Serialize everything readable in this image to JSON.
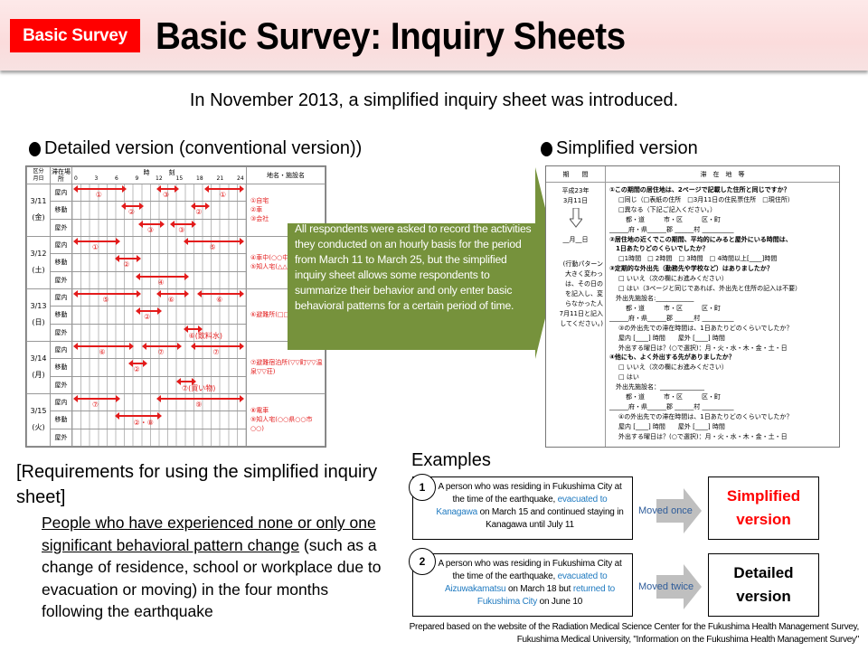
{
  "header": {
    "badge": "Basic Survey",
    "title": "Basic Survey: Inquiry Sheets"
  },
  "subtitle": "In November 2013, a simplified inquiry sheet was introduced.",
  "detailed": {
    "heading": "Detailed version (conventional version))",
    "sheet": {
      "corner_top": "区分",
      "corner_bottom": "月日",
      "stay_header": "滞在場所",
      "time_header": "時　　　刻",
      "hour_ticks": [
        "0",
        "3",
        "6",
        "9",
        "12",
        "15",
        "18",
        "21",
        "24"
      ],
      "place_header": "地名・施設名",
      "row_types": [
        "屋内",
        "移動",
        "屋外"
      ],
      "days": [
        {
          "date": "3/11",
          "dow": "(金)",
          "places": "①自宅\n②車\n③会社",
          "bars": [
            [
              {
                "from": 0,
                "to": 7,
                "label": "①"
              },
              {
                "from": 12,
                "to": 14.5,
                "label": "③"
              },
              {
                "from": 19,
                "to": 24,
                "label": "①"
              }
            ],
            [
              {
                "from": 7,
                "to": 9.5,
                "label": "②"
              },
              {
                "from": 17,
                "to": 19,
                "label": "②"
              }
            ],
            [
              {
                "from": 9.5,
                "to": 12.5,
                "label": "③"
              },
              {
                "from": 14,
                "to": 17,
                "label": "③"
              }
            ]
          ]
        },
        {
          "date": "3/12",
          "dow": "(土)",
          "places": "④車中(○○中学校校庭)\n⑤知人宅(△△町字△△)",
          "bars": [
            [
              {
                "from": 0,
                "to": 6,
                "label": "①"
              },
              {
                "from": 16,
                "to": 24,
                "label": "⑤"
              }
            ],
            [
              {
                "from": 6,
                "to": 9,
                "label": "②"
              }
            ],
            [
              {
                "from": 9,
                "to": 16,
                "label": "④"
              }
            ]
          ]
        },
        {
          "date": "3/13",
          "dow": "(日)",
          "places": "⑥避難所(□□中学校)",
          "bars": [
            [
              {
                "from": 0,
                "to": 9,
                "label": "⑤"
              },
              {
                "from": 12,
                "to": 16,
                "label": "⑥"
              },
              {
                "from": 18,
                "to": 24,
                "label": "⑥"
              }
            ],
            [
              {
                "from": 9,
                "to": 12,
                "label": "②"
              }
            ],
            [
              {
                "from": 16,
                "to": 18,
                "label": "⑥(飲料水)"
              }
            ]
          ]
        },
        {
          "date": "3/14",
          "dow": "(月)",
          "places": "⑦避難宿泊所(▽▽町▽▽温泉▽▽荘)",
          "bars": [
            [
              {
                "from": 0,
                "to": 8,
                "label": "⑥"
              },
              {
                "from": 10,
                "to": 15,
                "label": "⑦"
              },
              {
                "from": 17,
                "to": 24,
                "label": "⑦"
              }
            ],
            [
              {
                "from": 8,
                "to": 10,
                "label": "②"
              }
            ],
            [
              {
                "from": 15,
                "to": 17,
                "label": "⑦(買い物)"
              }
            ]
          ]
        },
        {
          "date": "3/15",
          "dow": "(火)",
          "places": "⑧電車\n⑨知人宅(○○県○○市○○)",
          "bars": [
            [
              {
                "from": 0,
                "to": 6,
                "label": "⑦"
              },
              {
                "from": 12,
                "to": 24,
                "label": "⑨"
              }
            ],
            [
              {
                "from": 6,
                "to": 12,
                "label": "②・⑧"
              }
            ],
            []
          ]
        }
      ]
    }
  },
  "callout": "All respondents were asked to record the activities they conducted on an hourly basis for the period from March 11 to March 25, but the simplified inquiry sheet allows some respondents to summarize their behavior and only enter basic behavioral patterns for a certain period of time.",
  "simplified": {
    "heading": "Simplified version",
    "sheet": {
      "col1_header": "期　　間",
      "col2_header": "滞　在　地　等",
      "left_lines": [
        "平成23年",
        "3月11日"
      ],
      "left_date": "__月__日",
      "left_note": [
        "(行動パターン",
        "大きく変わっ",
        "は、その日の",
        "を記入し、変",
        "らなかった人",
        "7月11日と記入",
        "してください。)"
      ],
      "lines": [
        {
          "cls": "q",
          "text": "①この期間の居住地は、2ページで記載した住所と同じですか？"
        },
        {
          "cls": "i1",
          "text": "□同じ（□表紙の住所　□3月11日の住民票住所　□現住所）"
        },
        {
          "cls": "i1",
          "text": "□異なる（下記ご記入ください。）"
        },
        {
          "cls": "i2",
          "text": "都・道　　　市・区　　　区・町"
        },
        {
          "cls": "",
          "text": "______府・県______郡 ______村 __________"
        },
        {
          "cls": "q",
          "text": "②居住地の近くでこの期間、平均的にみると屋外にいる時間は、"
        },
        {
          "cls": "q",
          "text": "　1日あたりどのくらいでしたか？"
        },
        {
          "cls": "i1",
          "text": "□1時間　□ 2時間　□ 3時間　□ 4時間以上[____]時間"
        },
        {
          "cls": "q",
          "text": "③定期的な外出先（勤務先や学校など）はありましたか？"
        },
        {
          "cls": "i1",
          "text": "□ いいえ（次の欄にお進みください）"
        },
        {
          "cls": "i1",
          "text": "□ はい（3ページと同じであれば、外出先と住所の記入は不要）"
        },
        {
          "cls": "",
          "text": "　外出先施設名:____________"
        },
        {
          "cls": "i2",
          "text": "都・道　　　市・区　　　区・町"
        },
        {
          "cls": "",
          "text": "______府・県______郡 ______村 __________"
        },
        {
          "cls": "i1",
          "text": "③の外出先での滞在時間は、1日あたりどのくらいでしたか？"
        },
        {
          "cls": "i1",
          "text": "屋内 [____] 時間　　屋外 [____] 時間"
        },
        {
          "cls": "i1",
          "text": "外出する曜日は？(○で選択)：月・火・水・木・金・土・日"
        },
        {
          "cls": "q",
          "text": "④他にも、よく外出する先がありましたか？"
        },
        {
          "cls": "i1",
          "text": "□ いいえ（次の欄にお進みください）"
        },
        {
          "cls": "i1",
          "text": "□ はい"
        },
        {
          "cls": "",
          "text": "　外出先施設名：______________"
        },
        {
          "cls": "i2",
          "text": "都・道　　　市・区　　　区・町"
        },
        {
          "cls": "",
          "text": "______府・県______郡 ______村 __________"
        },
        {
          "cls": "i1",
          "text": "④の外出先での滞在時間は、1日あたりどのくらいでしたか？"
        },
        {
          "cls": "i1",
          "text": "屋内 [____] 時間　　屋外 [____] 時間"
        },
        {
          "cls": "i1",
          "text": "外出する曜日は？(○で選択)：月・火・水・木・金・土・日"
        }
      ]
    }
  },
  "requirements": {
    "title": "[Requirements for using the simplified inquiry sheet]",
    "underlined": "People who have experienced none or only one significant behavioral pattern change",
    "rest": " (such as a change of residence, school or workplace due to evacuation or moving) in the four months following the earthquake"
  },
  "examples": {
    "title": "Examples",
    "items": [
      {
        "num": "1",
        "line1": "A person who was residing in Fukushima City at the time of the earthquake,",
        "link1": "evacuated to Kanagawa",
        "mid": " on March 15 and continued staying in Kanagawa until July 11",
        "link2": "",
        "end": "",
        "move": "Moved once",
        "result": "Simplified version",
        "result_color": "#ff0000"
      },
      {
        "num": "2",
        "line1": "A person who was residing in Fukushima City at the time of the earthquake,",
        "link1": "evacuated to Aizuwakamatsu",
        "mid": " on March 18 but ",
        "link2": "returned to Fukushima City",
        "end": " on June 10",
        "move": "Moved twice",
        "result": "Detailed version",
        "result_color": "#000000"
      }
    ]
  },
  "source": {
    "line1": "Prepared based on the website of the Radiation Medical Science Center for the Fukushima Health Management Survey,",
    "line2": "Fukushima Medical University, \"Information on the Fukushima Health Management Survey\""
  },
  "colors": {
    "badge": "#ff0000",
    "callout_green": "#76923c",
    "bar_red": "#e31b1b",
    "link_blue": "#1f7ac0"
  }
}
